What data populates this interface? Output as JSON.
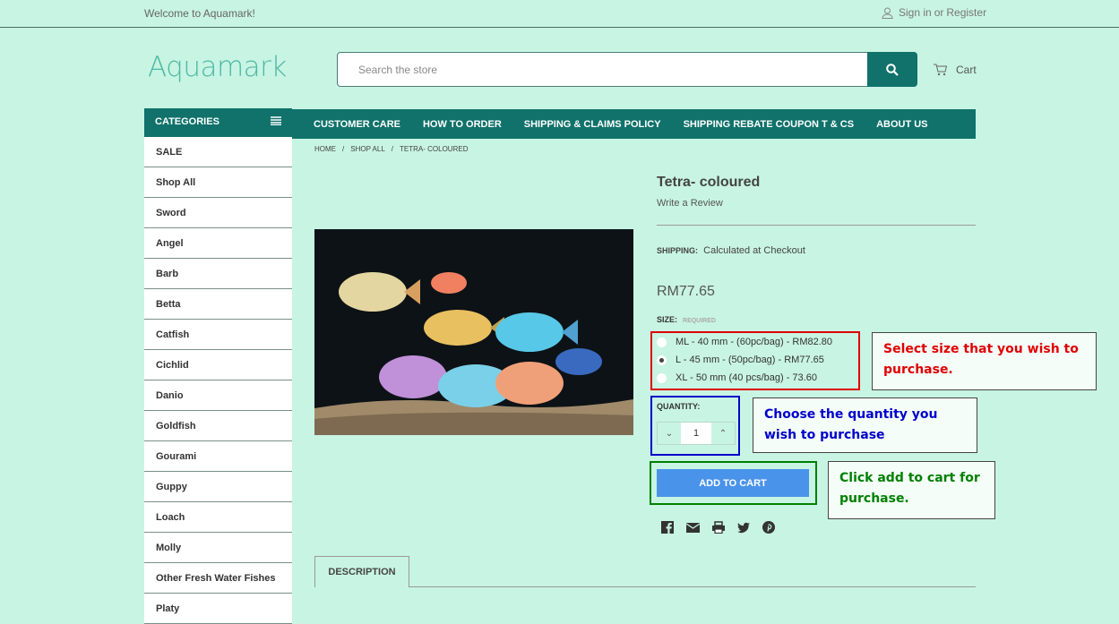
{
  "topbar": {
    "welcome": "Welcome to Aquamark!",
    "signin": "Sign in",
    "or": "or",
    "register": "Register"
  },
  "header": {
    "logo": "Aquamark",
    "search_placeholder": "Search the store",
    "cart": "Cart"
  },
  "sidebar": {
    "title": "CATEGORIES",
    "items": [
      "SALE",
      "Shop All",
      "Sword",
      "Angel",
      "Barb",
      "Betta",
      "Catfish",
      "Cichlid",
      "Danio",
      "Goldfish",
      "Gourami",
      "Guppy",
      "Loach",
      "Molly",
      "Other Fresh Water Fishes",
      "Platy"
    ]
  },
  "nav": [
    "CUSTOMER CARE",
    "HOW TO ORDER",
    "SHIPPING & CLAIMS POLICY",
    "SHIPPING REBATE COUPON T & CS",
    "ABOUT US"
  ],
  "breadcrumb": [
    "HOME",
    "/",
    "SHOP ALL",
    "/",
    "TETRA- COLOURED"
  ],
  "product": {
    "title": "Tetra- coloured",
    "review": "Write a Review",
    "shipping_label": "SHIPPING:",
    "shipping_value": "Calculated at Checkout",
    "price": "RM77.65",
    "size_label": "SIZE:",
    "required": "REQUIRED",
    "options": [
      {
        "label": "ML - 40 mm - (60pc/bag) - RM82.80",
        "selected": false
      },
      {
        "label": "L - 45 mm - (50pc/bag) - RM77.65",
        "selected": true
      },
      {
        "label": "XL - 50 mm (40 pcs/bag) - 73.60",
        "selected": false
      }
    ],
    "quantity_label": "QUANTITY:",
    "quantity": "1",
    "add_to_cart": "ADD TO CART"
  },
  "annotations": {
    "size": "Select size that you wish to purchase.",
    "quantity": "Choose the quantity you wish to purchase",
    "cart": "Click add to cart for purchase.",
    "colors": {
      "size": "#e00000",
      "quantity": "#0000cc",
      "cart": "#008000"
    }
  },
  "tabs": {
    "description": "DESCRIPTION"
  }
}
